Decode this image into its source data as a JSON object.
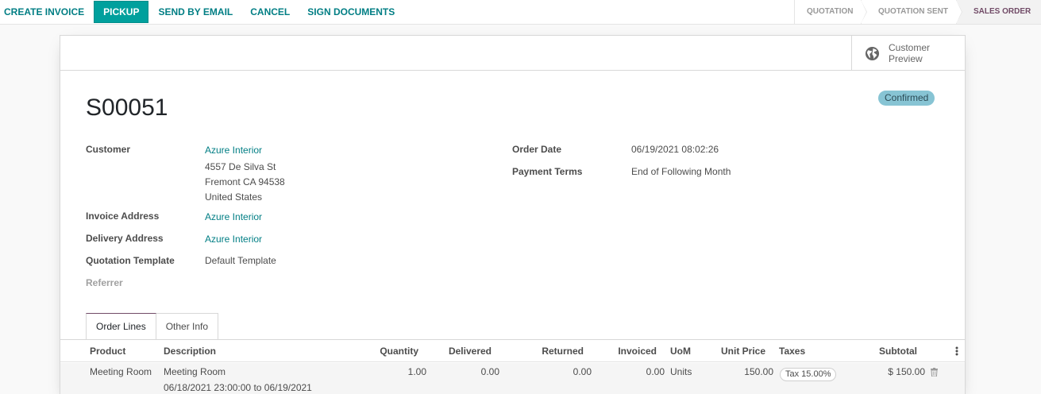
{
  "actions": [
    "CREATE INVOICE",
    "PICKUP",
    "SEND BY EMAIL",
    "CANCEL",
    "SIGN DOCUMENTS"
  ],
  "stages": [
    "QUOTATION",
    "QUOTATION SENT",
    "SALES ORDER"
  ],
  "active_stage": "SALES ORDER",
  "smart_button": {
    "label": "Customer Preview",
    "icon": "globe-icon"
  },
  "status_badge": "Confirmed",
  "order_name": "S00051",
  "fields": {
    "customer_label": "Customer",
    "customer_name": "Azure Interior",
    "customer_street": "4557 De Silva St",
    "customer_city": "Fremont CA 94538",
    "customer_country": "United States",
    "invoice_address_label": "Invoice Address",
    "invoice_address": "Azure Interior",
    "delivery_address_label": "Delivery Address",
    "delivery_address": "Azure Interior",
    "quotation_template_label": "Quotation Template",
    "quotation_template": "Default Template",
    "referrer_label": "Referrer",
    "order_date_label": "Order Date",
    "order_date": "06/19/2021 08:02:26",
    "payment_terms_label": "Payment Terms",
    "payment_terms": "End of Following Month"
  },
  "tabs": [
    "Order Lines",
    "Other Info"
  ],
  "table": {
    "columns": [
      "Product",
      "Description",
      "Quantity",
      "Delivered",
      "Returned",
      "Invoiced",
      "UoM",
      "Unit Price",
      "Taxes",
      "Subtotal"
    ],
    "rows": [
      {
        "product": "Meeting Room",
        "description": "Meeting Room",
        "description_2": "06/18/2021 23:00:00 to 06/19/2021",
        "quantity": "1.00",
        "delivered": "0.00",
        "returned": "0.00",
        "invoiced": "0.00",
        "uom": "Units",
        "unit_price": "150.00",
        "taxes": "Tax 15.00%",
        "subtotal": "$ 150.00"
      }
    ]
  },
  "colors": {
    "accent": "#017e84",
    "primary_button": "#00a09d",
    "brand": "#714b67",
    "badge": "#87c4d4"
  }
}
